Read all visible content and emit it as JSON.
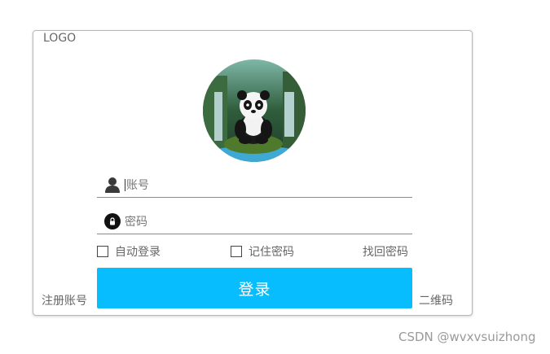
{
  "logo": "LOGO",
  "avatar_icon": "panda-avatar",
  "account": {
    "placeholder": "账号",
    "icon": "user-icon"
  },
  "password": {
    "placeholder": "密码",
    "icon": "lock-icon"
  },
  "options": {
    "auto_login": "自动登录",
    "remember_password": "记住密码",
    "forgot_password": "找回密码"
  },
  "login_button": "登录",
  "register": "注册账号",
  "qrcode": "二维码",
  "watermark": "CSDN @wvxvsuizhong",
  "colors": {
    "accent": "#08bdfd",
    "border": "#b8b8b8"
  }
}
